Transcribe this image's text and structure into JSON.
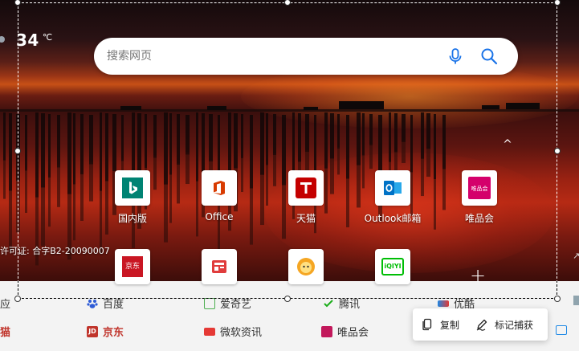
{
  "weather": {
    "temperature": "34",
    "unit": "℃"
  },
  "search": {
    "placeholder": "搜索网页",
    "icons": [
      "microphone-icon",
      "search-icon"
    ]
  },
  "tiles": [
    {
      "label": "国内版",
      "icon": "bing-icon",
      "color": "#008373"
    },
    {
      "label": "Office",
      "icon": "office-icon",
      "color": "#d83b01"
    },
    {
      "label": "天猫",
      "icon": "tmall-icon",
      "color": "#c40000"
    },
    {
      "label": "Outlook邮箱",
      "icon": "outlook-icon",
      "color": "#0072c6"
    },
    {
      "label": "唯品会",
      "icon": "vipshop-icon",
      "color": "#d4006b"
    },
    {
      "label": "",
      "icon": "jd-icon",
      "icon_text": "京东",
      "color": "#c91623"
    },
    {
      "label": "",
      "icon": "msn-news-icon",
      "color": "#e03c3c"
    },
    {
      "label": "",
      "icon": "cartoon-sun-icon",
      "color": "#f5a623"
    },
    {
      "label": "",
      "icon": "iqiyi-icon",
      "icon_text": "iQIYI",
      "color": "#00be06"
    }
  ],
  "license_text": "许可证: 合字B2-20090007",
  "collapse_glyph": "^",
  "plus_glyph": "+",
  "bottom_links": {
    "row1": [
      "应",
      "百度",
      "爱奇艺",
      "腾讯",
      "优酷"
    ],
    "row2": [
      "猫",
      "京东",
      "微软资讯",
      "唯品会"
    ]
  },
  "toolbar": {
    "copy_label": "复制",
    "annotate_label": "标记捕获"
  },
  "colors": {
    "accent": "#1a73e8",
    "tmall_red": "#c0342b",
    "selection": "#ffffff"
  }
}
